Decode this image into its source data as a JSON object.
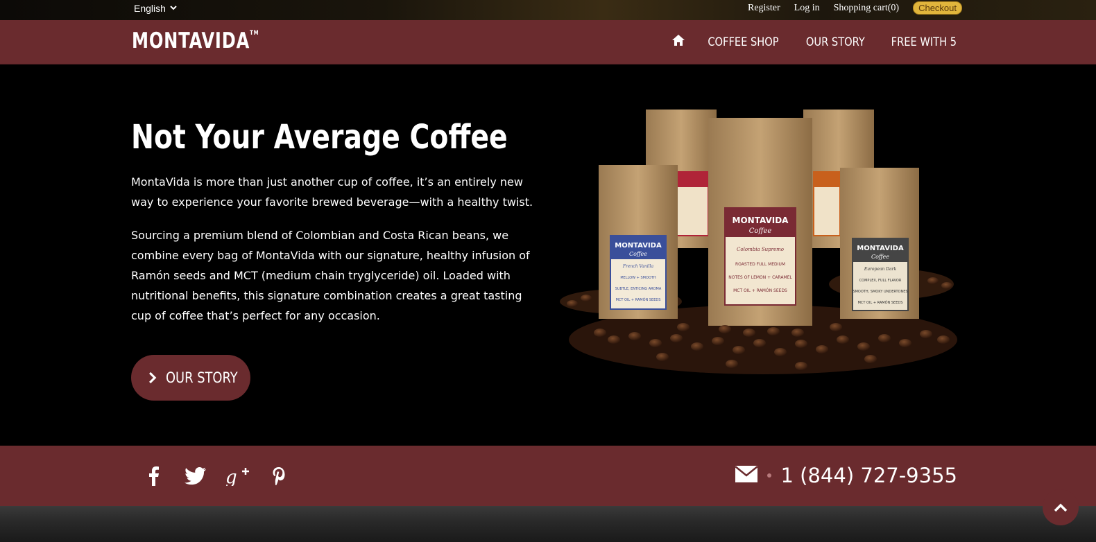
{
  "topbar": {
    "language": "English",
    "links": [
      "Register",
      "Log in",
      "Shopping cart(0)"
    ],
    "checkout": "Checkout"
  },
  "brand": {
    "logo": "MONTAVIDA",
    "tm": "TM"
  },
  "nav": {
    "items": [
      "COFFEE SHOP",
      "OUR STORY",
      "FREE WITH 5"
    ]
  },
  "hero": {
    "title": "Not Your Average Coffee",
    "paragraph1": "MontaVida is more than just another cup of coffee, it’s an entirely new way to experience your favorite brewed beverage—with a healthy twist.",
    "paragraph2": "Sourcing a premium blend of Colombian and Costa Rican beans, we combine every bag of MontaVida with our signature, healthy infusion of Ramón seeds and MCT (medium chain tryglyceride) oil. Loaded with nutritional benefits, this signature combination creates a great tasting cup of coffee that’s perfect for any occasion.",
    "button": "OUR STORY"
  },
  "bags": {
    "brand": "MONTAVIDA",
    "sub": "Coffee",
    "left": {
      "name": "French Vanilla",
      "lines": [
        "MELLOW + SMOOTH",
        "SUBTLE, ENTICING AROMA",
        "MCT OIL + RAMÓN SEEDS"
      ]
    },
    "center": {
      "name": "Colombia Supremo",
      "lines": [
        "ROASTED FULL MEDIUM",
        "NOTES OF LEMON + CARAMEL",
        "MCT OIL + RAMÓN SEEDS"
      ]
    },
    "right": {
      "name": "European Dark",
      "lines": [
        "COMPLEX, FULL FLAVOR",
        "SMOOTH, SMOKY UNDERTONES",
        "MCT OIL + RAMÓN SEEDS"
      ]
    }
  },
  "footer": {
    "social": [
      "facebook-icon",
      "twitter-icon",
      "google-plus-icon",
      "pinterest-icon"
    ],
    "phone": "1 (844) 727-9355"
  },
  "colors": {
    "brand_maroon": "#6a2b2e",
    "checkout_gold": "#e1b53c",
    "background": "#000000"
  }
}
